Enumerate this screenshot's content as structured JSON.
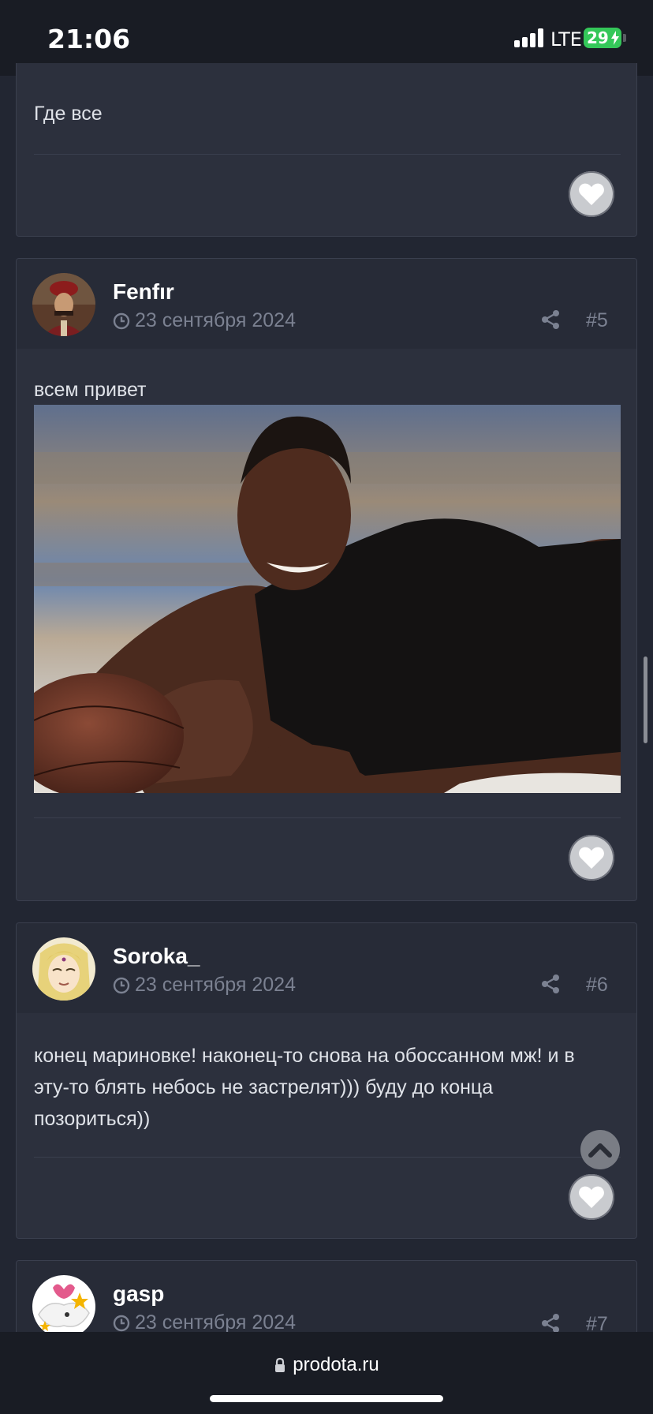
{
  "status_bar": {
    "time": "21:06",
    "network": "LTE",
    "battery": "29",
    "battery_level": 0.29
  },
  "posts": [
    {
      "text": "Где все"
    },
    {
      "author": "Fenfır",
      "date": "23 сентября 2024",
      "num": "#5",
      "text": "всем привет"
    },
    {
      "author": "Soroka_",
      "date": "23 сентября 2024",
      "num": "#6",
      "text": "конец мариновке! наконец-то снова на обоссанном мж! и в эту-то блять небось не застрелят))) буду до конца позориться))"
    },
    {
      "author": "gasp",
      "date": "23 сентября 2024",
      "num": "#7"
    }
  ],
  "browser": {
    "url": "prodota.ru"
  },
  "icons": {
    "like": "heart-icon",
    "share": "share-icon",
    "clock": "clock-icon",
    "scroll_top": "chevron-up-icon",
    "lock": "lock-icon"
  },
  "colors": {
    "background": "#222632",
    "card": "#2c303d",
    "card_header": "#272b37",
    "muted_text": "#7b8191",
    "battery_green": "#34c759"
  }
}
